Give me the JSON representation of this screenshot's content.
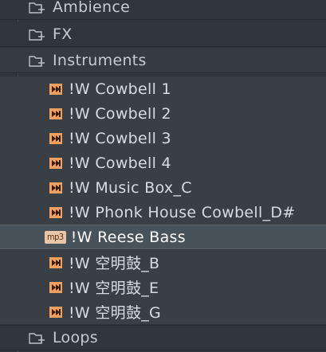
{
  "browser": {
    "folders_top": [
      {
        "label": "Ambience",
        "icon": "folder-icon"
      },
      {
        "label": "FX",
        "icon": "folder-icon"
      },
      {
        "label": "Instruments",
        "icon": "folder-open-icon"
      }
    ],
    "files": [
      {
        "label": "!W Cowbell 1",
        "icon": "fl-sample-icon"
      },
      {
        "label": "!W Cowbell 2",
        "icon": "fl-sample-icon"
      },
      {
        "label": "!W Cowbell 3",
        "icon": "fl-sample-icon"
      },
      {
        "label": "!W Cowbell 4",
        "icon": "fl-sample-icon"
      },
      {
        "label": "!W Music Box_C",
        "icon": "fl-sample-icon"
      },
      {
        "label": "!W Phonk House Cowbell_D#",
        "icon": "fl-sample-icon"
      },
      {
        "label": "!W Reese Bass",
        "icon": "mp3-icon",
        "icon_text": "mp3",
        "selected": true
      },
      {
        "label": "!W 空明鼓_B",
        "icon": "fl-sample-icon"
      },
      {
        "label": "!W 空明鼓_E",
        "icon": "fl-sample-icon"
      },
      {
        "label": "!W 空明鼓_G",
        "icon": "fl-sample-icon"
      }
    ],
    "folders_bottom": [
      {
        "label": "Loops",
        "icon": "folder-icon"
      }
    ]
  },
  "colors": {
    "background": "#2f353a",
    "file_row": "#384046",
    "selected_row": "#48525a",
    "icon_accent": "#f0a060"
  }
}
